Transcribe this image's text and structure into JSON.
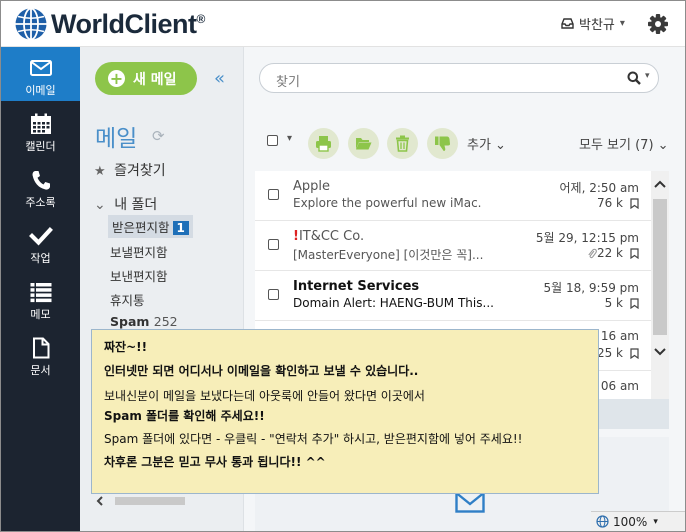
{
  "header": {
    "app_name": "WorldClient",
    "registered_mark": "®",
    "user_name": "박찬규",
    "user_caret": "▾"
  },
  "nav": {
    "items": [
      {
        "label": "이메일",
        "icon": "envelope-icon",
        "active": true
      },
      {
        "label": "캘린더",
        "icon": "calendar-icon",
        "active": false
      },
      {
        "label": "주소록",
        "icon": "phone-icon",
        "active": false
      },
      {
        "label": "작업",
        "icon": "checkmark-icon",
        "active": false
      },
      {
        "label": "메모",
        "icon": "list-icon",
        "active": false
      },
      {
        "label": "문서",
        "icon": "document-icon",
        "active": false
      }
    ]
  },
  "folders": {
    "new_mail_label": "새 메일",
    "new_mail_plus": "+",
    "collapse": "«",
    "heading": "메일",
    "refresh": "⟳",
    "favorites_star": "★",
    "favorites_label": "즐겨찾기",
    "my_folders_caret": "⌄",
    "my_folders_label": "내 폴더",
    "items": {
      "inbox": "받은편지함",
      "inbox_count": "1",
      "drafts": "보낼편지함",
      "sent": "보낸편지함",
      "trash": "휴지통",
      "spam": "Spam",
      "spam_count": "252"
    }
  },
  "search": {
    "placeholder": "찾기",
    "caret": "▾"
  },
  "toolbar": {
    "check_caret": "▾",
    "more_label": "추가 ⌄",
    "view_label": "모두 보기 (7) ⌄"
  },
  "messages": [
    {
      "sender": "Apple",
      "subject": "Explore the powerful new iMac.",
      "date": "어제, 2:50 am",
      "size": "76 k",
      "unread": false,
      "flagged": false,
      "attachment": false
    },
    {
      "sender": "IT&CC Co.",
      "flag_prefix": "!",
      "subject": "[MasterEveryone] [이것만은 꼭]...",
      "date": "5월 29, 12:15 pm",
      "size": "22 k",
      "unread": false,
      "flagged": true,
      "attachment": true
    },
    {
      "sender": "Internet Services",
      "subject": "Domain Alert: HAENG-BUM This...",
      "date": "5월 18, 9:59 pm",
      "size": "5 k",
      "unread": true,
      "flagged": false,
      "attachment": false
    },
    {
      "sender": "",
      "subject": "",
      "date": "16 am",
      "size": "25 k",
      "unread": false,
      "flagged": false,
      "attachment": false
    },
    {
      "sender": "",
      "subject": "",
      "date": "06 am",
      "size": "",
      "unread": false,
      "flagged": false,
      "attachment": false
    }
  ],
  "statusbar": {
    "zoom": "100%",
    "zoom_caret": "▾"
  },
  "notice": {
    "line1": "짜잔~!!",
    "line2": "인터넷만 되면 어디서나 이메일을 확인하고 보낼 수 있습니다..",
    "line3": "보내신분이 메일을 보냈다는데 아웃룩에 안들어 왔다면 이곳에서",
    "line4": "Spam 폴더를 확인해 주세요!!",
    "line5": "Spam 폴더에 있다면 - 우클릭 - \"연락처 추가\" 하시고, 받은편지함에 넣어 주세요!!",
    "line6": "차후론 그분은 믿고 무사 통과 됩니다!! ^^"
  },
  "colors": {
    "nav_bg": "#1c2430",
    "nav_active": "#1e7dc8",
    "new_mail_green": "#8dc54a",
    "accent_blue": "#4a8fc9",
    "notice_bg": "#f7eeb9"
  }
}
